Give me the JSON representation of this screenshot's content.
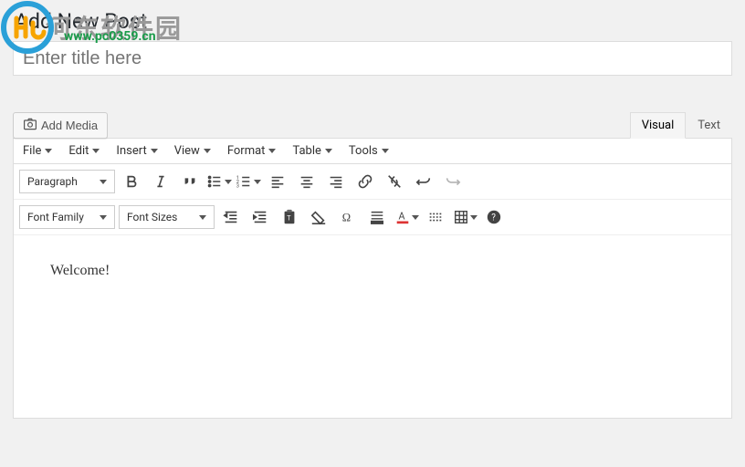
{
  "page": {
    "heading": "Add New Post"
  },
  "title_input": {
    "placeholder": "Enter title here",
    "value": ""
  },
  "watermark": {
    "site_text": "河东软件园",
    "url_text": "www.pc0359.cn"
  },
  "media": {
    "add_label": "Add Media"
  },
  "tabs": {
    "visual": "Visual",
    "text": "Text",
    "active": "visual"
  },
  "menubar": [
    "File",
    "Edit",
    "Insert",
    "View",
    "Format",
    "Table",
    "Tools"
  ],
  "toolbar1": {
    "format_dropdown": "Paragraph",
    "buttons": [
      "bold",
      "italic",
      "blockquote",
      "bullist",
      "numlist",
      "alignleft",
      "aligncenter",
      "alignright",
      "link",
      "unlink",
      "undo",
      "redo"
    ]
  },
  "toolbar2": {
    "fontfamily": "Font Family",
    "fontsize": "Font Sizes",
    "buttons": [
      "outdent",
      "indent",
      "paste",
      "clearformat",
      "specialchar",
      "letterspacing",
      "textcolor",
      "hr",
      "table",
      "help"
    ]
  },
  "content": {
    "text": "Welcome!"
  },
  "icons": {
    "camera": "camera-icon",
    "bold": "bold-icon",
    "italic": "italic-icon",
    "blockquote": "quote-icon",
    "bullist": "bullet-list-icon",
    "numlist": "number-list-icon",
    "alignleft": "align-left-icon",
    "aligncenter": "align-center-icon",
    "alignright": "align-right-icon",
    "link": "link-icon",
    "unlink": "unlink-icon",
    "undo": "undo-icon",
    "redo": "redo-icon",
    "outdent": "outdent-icon",
    "indent": "indent-icon",
    "paste": "paste-icon",
    "clearformat": "eraser-icon",
    "specialchar": "omega-icon",
    "letterspacing": "letterspacing-icon",
    "textcolor": "textcolor-icon",
    "hr": "hr-icon",
    "table": "table-icon",
    "help": "help-icon"
  }
}
